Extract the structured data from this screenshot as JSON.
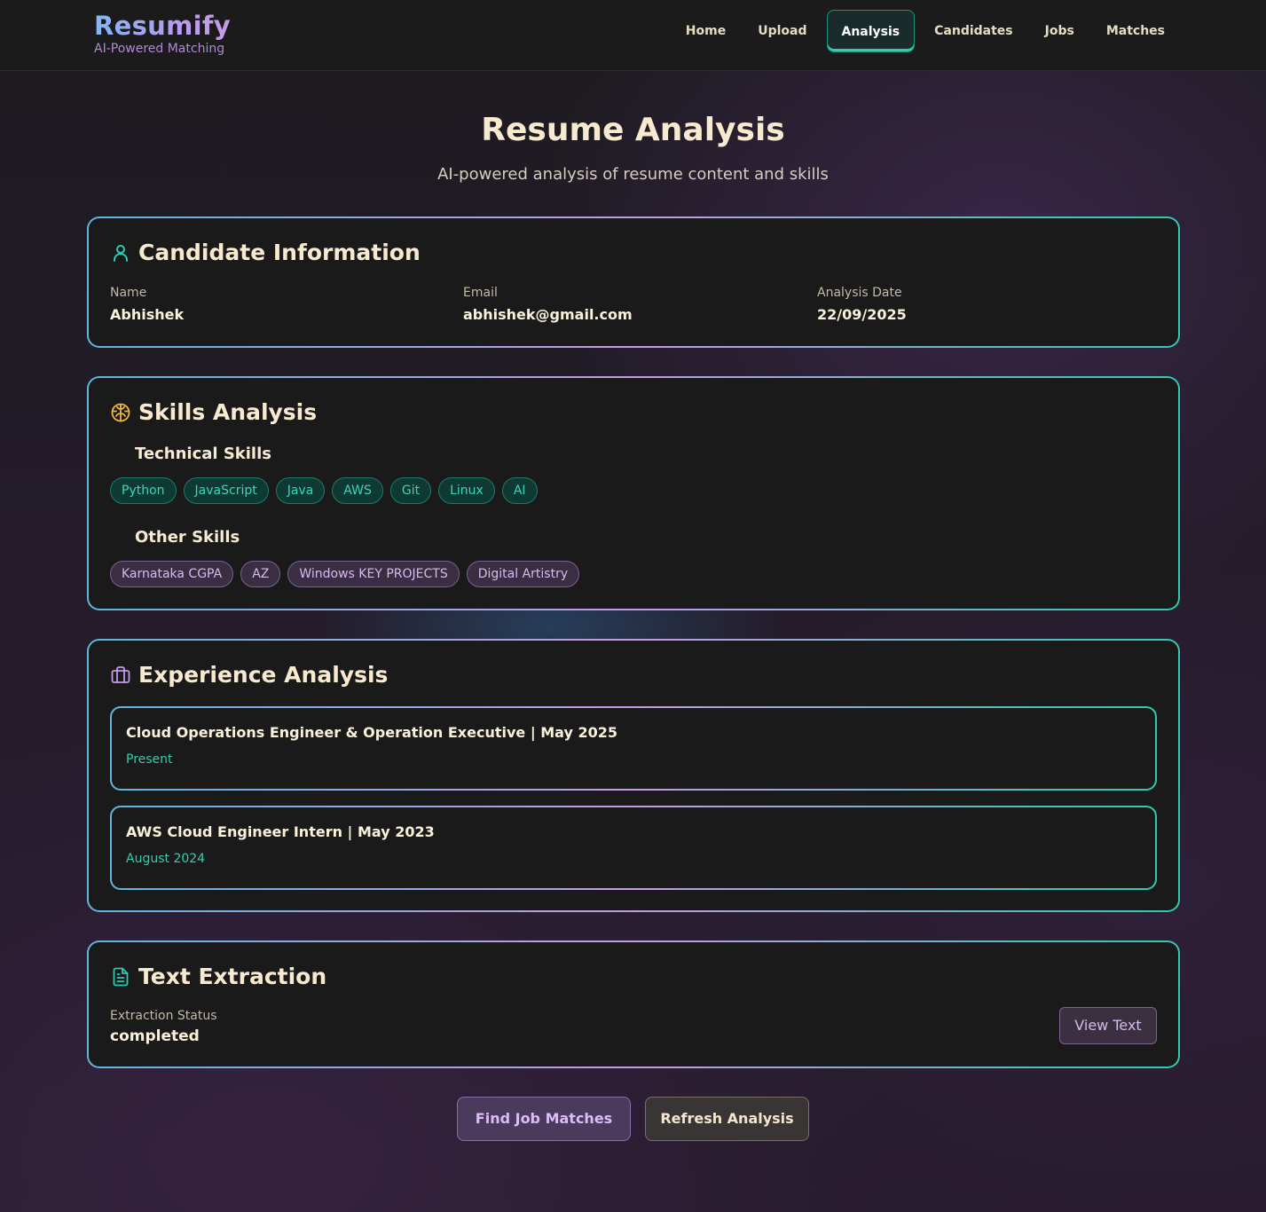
{
  "brand": {
    "name": "Resumify",
    "tagline": "AI-Powered Matching"
  },
  "nav": {
    "items": [
      {
        "label": "Home",
        "active": false
      },
      {
        "label": "Upload",
        "active": false
      },
      {
        "label": "Analysis",
        "active": true
      },
      {
        "label": "Candidates",
        "active": false
      },
      {
        "label": "Jobs",
        "active": false
      },
      {
        "label": "Matches",
        "active": false
      }
    ]
  },
  "header": {
    "title": "Resume Analysis",
    "subtitle": "AI-powered analysis of resume content and skills"
  },
  "candidate": {
    "title": "Candidate Information",
    "name_label": "Name",
    "name": "Abhishek",
    "email_label": "Email",
    "email": "abhishek@gmail.com",
    "date_label": "Analysis Date",
    "date": "22/09/2025"
  },
  "skills": {
    "title": "Skills Analysis",
    "technical_title": "Technical Skills",
    "technical": [
      "Python",
      "JavaScript",
      "Java",
      "AWS",
      "Git",
      "Linux",
      "AI"
    ],
    "other_title": "Other Skills",
    "other": [
      "Karnataka CGPA",
      "AZ",
      "Windows KEY PROJECTS",
      "Digital Artistry"
    ]
  },
  "experience": {
    "title": "Experience Analysis",
    "items": [
      {
        "title": "Cloud Operations Engineer & Operation Executive | May 2025",
        "period": "Present"
      },
      {
        "title": "AWS Cloud Engineer Intern | May 2023",
        "period": "August 2024"
      }
    ]
  },
  "extraction": {
    "title": "Text Extraction",
    "status_label": "Extraction Status",
    "status": "completed",
    "view_button": "View Text"
  },
  "actions": {
    "find_matches": "Find Job Matches",
    "refresh": "Refresh Analysis"
  },
  "colors": {
    "accent_teal": "#2ec9b0",
    "accent_purple": "#c59ae8",
    "accent_blue": "#5fb5e0",
    "heading": "#f8ead0"
  }
}
